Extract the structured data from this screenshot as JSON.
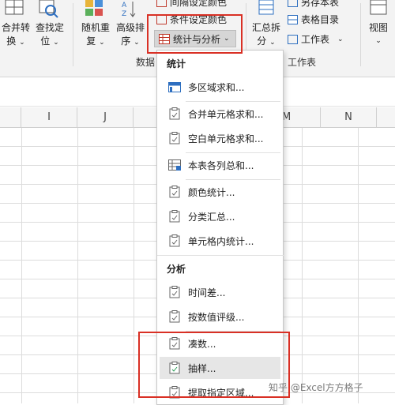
{
  "ribbon": {
    "merge_convert_l1": "合并转",
    "merge_convert_l2": "换",
    "find_locate_l1": "查找定",
    "find_locate_l2": "位",
    "random_l1": "随机重",
    "random_l2": "复",
    "advanced_l1": "高级排",
    "advanced_l2": "序",
    "interval_color": "间隔设定颜色",
    "conditional_color": "条件设定颜色",
    "stats_button": "统计与分析",
    "data_group": "数据",
    "summary_split_l1": "汇总拆",
    "summary_split_l2": "分",
    "save_as_table": "另存本表",
    "table_toc": "表格目录",
    "worksheet": "工作表",
    "worksheet_group": "工作表",
    "view": "视图"
  },
  "columns": [
    "I",
    "J",
    "M",
    "N"
  ],
  "menu": {
    "section_stats": "统计",
    "items_stats": [
      "多区域求和...",
      "合并单元格求和...",
      "空白单元格求和...",
      "本表各列总和...",
      "颜色统计...",
      "分类汇总...",
      "单元格内统计..."
    ],
    "section_analysis": "分析",
    "items_analysis": [
      "时间差...",
      "按数值评级...",
      "凑数...",
      "抽样...",
      "提取指定区域..."
    ]
  },
  "watermark": "知乎 @Excel方方格子",
  "colors": {
    "highlight_box": "#d93025",
    "menu_hover": "#e6e6e6",
    "ribbon_bg": "#f3f3f3"
  }
}
